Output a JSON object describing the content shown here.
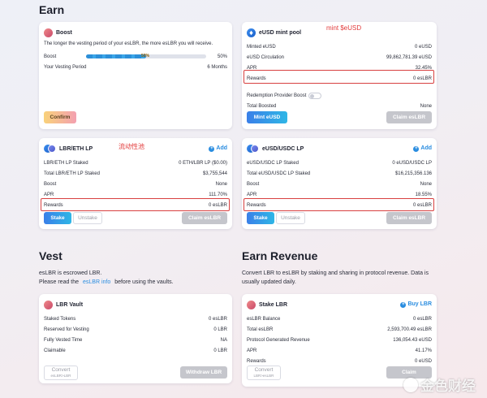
{
  "sections": {
    "earn": "Earn",
    "vest": "Vest",
    "earn_revenue": "Earn Revenue"
  },
  "boost_card": {
    "title": "Boost",
    "desc": "The longer the vesting period of your esLBR, the more esLBR you will receive.",
    "boost_label": "Boost",
    "boost_bar_label": "50%",
    "boost_value": "50%",
    "boost_fraction": 0.5,
    "period_label": "Your Vesting Period",
    "period_value": "6 Months",
    "confirm": "Confirm"
  },
  "eusd_mint_card": {
    "title": "eUSD mint pool",
    "annotation": "mint $eUSD",
    "rows": [
      {
        "label": "Minted eUSD",
        "value": "0 eUSD"
      },
      {
        "label": "eUSD Circulation",
        "value": "99,862,781.39 eUSD"
      },
      {
        "label": "APR",
        "value": "32.45%"
      },
      {
        "label": "Rewards",
        "value": "0 esLBR"
      }
    ],
    "redemption_label": "Redemption Provider Boost",
    "total_boosted_label": "Total Boosted",
    "total_boosted_value": "None",
    "mint_button": "Mint eUSD",
    "claim_button": "Claim esLBR"
  },
  "lbr_eth_card": {
    "title": "LBR/ETH LP",
    "annotation": "流动性池",
    "add": "Add",
    "rows": [
      {
        "label": "LBR/ETH LP Staked",
        "value": "0 ETH/LBR LP ($0.00)"
      },
      {
        "label": "Total LBR/ETH LP Staked",
        "value": "$3,755,544"
      },
      {
        "label": "Boost",
        "value": "None"
      },
      {
        "label": "APR",
        "value": "111.70%"
      },
      {
        "label": "Rewards",
        "value": "0 esLBR"
      }
    ],
    "stake": "Stake",
    "unstake": "Unstake",
    "claim": "Claim esLBR"
  },
  "eusd_usdc_card": {
    "title": "eUSD/USDC LP",
    "add": "Add",
    "rows": [
      {
        "label": "eUSD/USDC LP Staked",
        "value": "0 eUSD/USDC LP"
      },
      {
        "label": "Total eUSD/USDC LP Staked",
        "value": "$16,215,356.136"
      },
      {
        "label": "Boost",
        "value": "None"
      },
      {
        "label": "APR",
        "value": "18.55%"
      },
      {
        "label": "Rewards",
        "value": "0 esLBR"
      }
    ],
    "stake": "Stake",
    "unstake": "Unstake",
    "claim": "Claim esLBR"
  },
  "vest_text": {
    "line1": "esLBR is escrowed LBR.",
    "line2_pre": "Please read the",
    "line2_link": "esLBR info",
    "line2_post": "before using the vaults."
  },
  "earn_revenue_text": {
    "line1": "Convert LBR to esLBR by staking and sharing in protocol revenue. Data is",
    "line2": "usually updated daily."
  },
  "lbr_vault_card": {
    "title": "LBR Vault",
    "rows": [
      {
        "label": "Staked Tokens",
        "value": "0 esLBR"
      },
      {
        "label": "Reserved for Vesting",
        "value": "0 LBR"
      },
      {
        "label": "Fully Vested Time",
        "value": "NA"
      },
      {
        "label": "Claimable",
        "value": "0 LBR"
      }
    ],
    "convert": "Convert",
    "convert_sub": "esLBR>LBR",
    "withdraw": "Withdraw LBR"
  },
  "stake_lbr_card": {
    "title": "Stake LBR",
    "buy": "Buy LBR",
    "rows": [
      {
        "label": "esLBR Balance",
        "value": "0 esLBR"
      },
      {
        "label": "Total esLBR",
        "value": "2,593,700.49 esLBR"
      },
      {
        "label": "Protocol Generated Revenue",
        "value": "136,054.43 eUSD"
      },
      {
        "label": "APR",
        "value": "41.17%"
      },
      {
        "label": "Rewards",
        "value": "0 eUSD"
      }
    ],
    "convert": "Convert",
    "convert_sub": "LBR>esLBR",
    "claim": "Claim"
  },
  "watermark": "金色财经"
}
